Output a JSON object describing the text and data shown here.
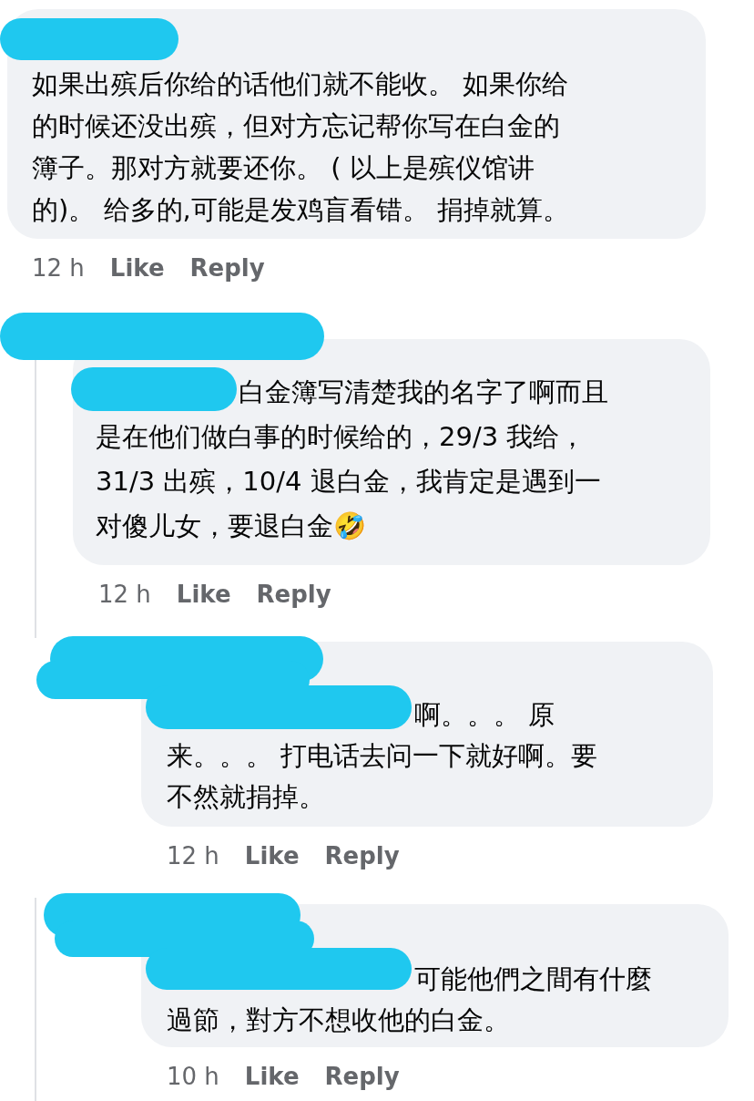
{
  "comments": [
    {
      "lines": [
        "如果出殡后你给的话他们就不能收。 如果你给",
        "的时候还没出殡，但对方忘记帮你写在白金的",
        "簿子。那对方就要还你。 ( 以上是殡仪馆讲",
        "的)。 给多的,可能是发鸡盲看错。 捐掉就算。"
      ],
      "time": "12 h",
      "actions": [
        "Like",
        "Reply"
      ]
    },
    {
      "lines": [
        "白金簿写清楚我的名字了啊而且",
        "是在他们做白事的时候给的，29/3 我给，",
        "31/3 出殡，10/4 退白金，我肯定是遇到一",
        "对傻儿女，要退白金🤣"
      ],
      "time": "12 h",
      "actions": [
        "Like",
        "Reply"
      ]
    },
    {
      "lines": [
        "啊。。。 原",
        "来。。。 打电话去问一下就好啊。要",
        "不然就捐掉。"
      ],
      "time": "12 h",
      "actions": [
        "Like",
        "Reply"
      ]
    },
    {
      "lines": [
        "可能他們之間有什麼",
        "過節，對方不想收他的白金。"
      ],
      "time": "10 h",
      "actions": [
        "Like",
        "Reply"
      ]
    }
  ]
}
